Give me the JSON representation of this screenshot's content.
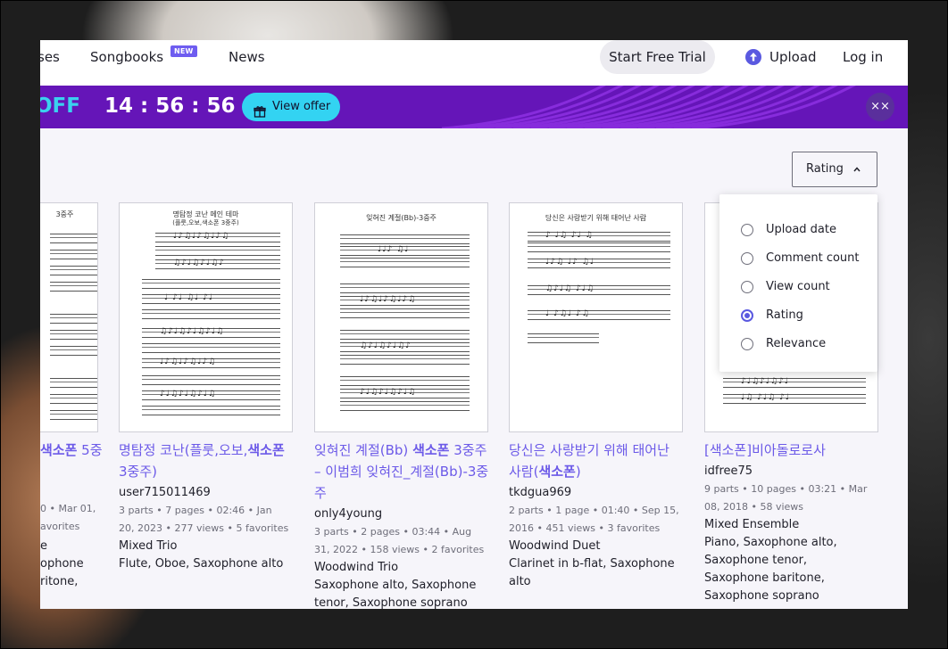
{
  "nav": {
    "courses_partial": "ses",
    "songbooks": "Songbooks",
    "new_badge": "NEW",
    "news": "News",
    "start_trial": "Start Free Trial",
    "upload": "Upload",
    "login": "Log in"
  },
  "banner": {
    "off_partial": "OFF",
    "timer": "14 : 56 : 56",
    "view_offer": "View offer",
    "close": "××",
    "color": "#6515b8"
  },
  "sort": {
    "label": "Rating",
    "chevron": "⌃",
    "options": [
      "Upload date",
      "Comment count",
      "View count",
      "Rating",
      "Relevance"
    ],
    "selected": "Rating"
  },
  "cards": [
    {
      "title_pre": "",
      "title_bold": "색소폰",
      "title_post": " 5중",
      "sheet_title": "",
      "sheet_title_partial": "3중주",
      "meta": "0 • Mar 01,",
      "meta2": "avorites",
      "ensemble": "e",
      "instruments": "ophone\nritone,"
    },
    {
      "title_pre": "명탐정 코난(플룻,오보,",
      "title_bold": "색소폰",
      "title_post": " 3중주)",
      "user": "user715011469",
      "meta": "3 parts • 7 pages • 02:46 • Jan 20, 2023 • 277 views • 5 favorites",
      "ensemble": "Mixed Trio",
      "instruments": "Flute, Oboe, Saxophone alto",
      "sheet_title": "명탐정 코난 메인 테마",
      "sheet_subtitle": "(플룻,오보,색소폰 3중주)"
    },
    {
      "title_pre": "잊혀진 계절(Bb) ",
      "title_bold": "색소폰",
      "title_post": " 3중주 – 이범희 잊혀진_계절(Bb)-3중주",
      "user": "only4young",
      "meta": "3 parts • 2 pages • 03:44 • Aug 31, 2022 • 158 views • 2 favorites",
      "ensemble": "Woodwind Trio",
      "instruments": "Saxophone alto, Saxophone tenor, Saxophone soprano",
      "sheet_title": "잊혀진 계절(Bb)-3중주"
    },
    {
      "title_pre": "당신은 사랑받기 위해 태어난 사람(",
      "title_bold": "색소폰",
      "title_post": ")",
      "user": "tkdgua969",
      "meta": "2 parts • 1 page • 01:40 • Sep 15, 2016 • 451 views • 3 favorites",
      "ensemble": "Woodwind Duet",
      "instruments": "Clarinet in b-flat, Saxophone alto",
      "sheet_title": "당신은 사랑받기 위해 태어난 사람"
    },
    {
      "title_pre": "[",
      "title_bold": "",
      "title_post": "색소폰]비아돌로로사",
      "user": "idfree75",
      "meta": "9 parts • 10 pages • 03:21 • Mar 08, 2018 • 58 views",
      "ensemble": "Mixed Ensemble",
      "instruments": "Piano, Saxophone alto, Saxophone tenor, Saxophone baritone, Saxophone soprano"
    }
  ]
}
